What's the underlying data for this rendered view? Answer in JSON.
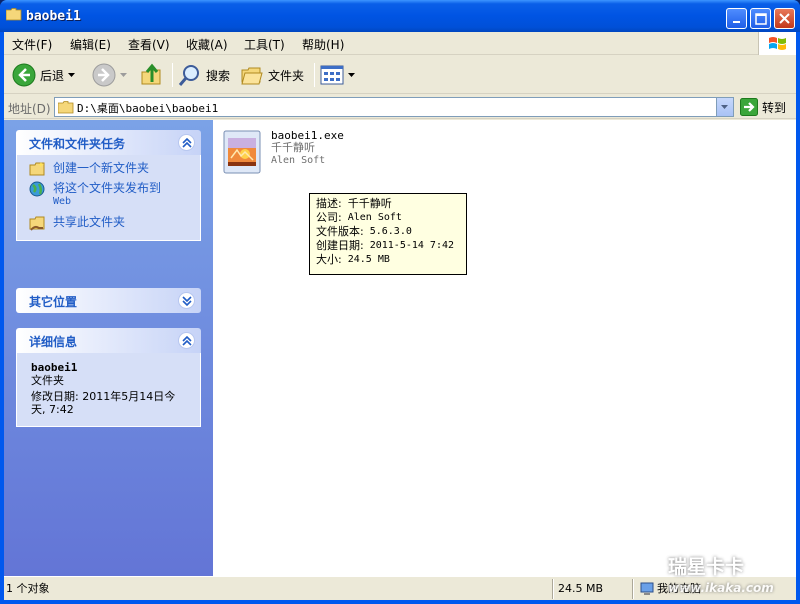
{
  "window": {
    "title": "baobei1"
  },
  "menu": {
    "items": [
      "文件(F)",
      "编辑(E)",
      "查看(V)",
      "收藏(A)",
      "工具(T)",
      "帮助(H)"
    ]
  },
  "toolbar": {
    "back_label": "后退",
    "search_label": "搜索",
    "folders_label": "文件夹"
  },
  "address": {
    "label": "地址(D)",
    "path": "D:\\桌面\\baobei\\baobei1",
    "go_label": "转到"
  },
  "taskpane": {
    "file_tasks": {
      "title": "文件和文件夹任务",
      "items": [
        {
          "label": "创建一个新文件夹",
          "sub": ""
        },
        {
          "label": "将这个文件夹发布到",
          "sub": "Web"
        },
        {
          "label": "共享此文件夹",
          "sub": ""
        }
      ]
    },
    "other_places": {
      "title": "其它位置"
    },
    "details": {
      "title": "详细信息",
      "name": "baobei1",
      "type": "文件夹",
      "modified_line1": "修改日期: 2011年5月14日今",
      "modified_line2": "天, 7:42"
    }
  },
  "content": {
    "file": {
      "name": "baobei1.exe",
      "description": "千千静听",
      "company": "Alen Soft"
    },
    "tooltip": {
      "desc_label": "描述:",
      "desc_value": "千千静听",
      "company_label": "公司:",
      "company_value": "Alen Soft",
      "version_label": "文件版本:",
      "version_value": "5.6.3.0",
      "created_label": "创建日期:",
      "created_value": "2011-5-14 7:42",
      "size_label": "大小:",
      "size_value": "24.5 MB"
    }
  },
  "status": {
    "objects": "1 个对象",
    "size": "24.5 MB",
    "location": "我的电脑"
  },
  "watermark": {
    "brand": "瑞星卡卡",
    "url": "www.ikaka.com"
  },
  "colors": {
    "titlebar": "#0054e3",
    "taskpane": "#7ba2e7",
    "link": "#215dc6",
    "tooltip_bg": "#ffffe1"
  }
}
